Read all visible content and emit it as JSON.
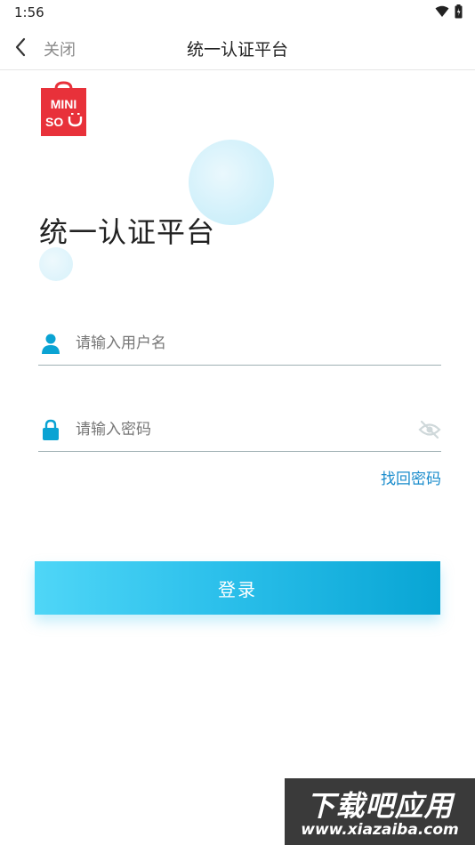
{
  "status_bar": {
    "time": "1:56",
    "icons": [
      "wifi-icon",
      "battery-icon"
    ]
  },
  "nav": {
    "close_label": "关闭",
    "title": "统一认证平台",
    "back_icon": "chevron-left-icon"
  },
  "logo": {
    "line1": "MINI",
    "line2": "SO",
    "brand_color": "#e8313a"
  },
  "main": {
    "title": "统一认证平台"
  },
  "form": {
    "username": {
      "placeholder": "请输入用户名",
      "value": "",
      "icon": "user-icon"
    },
    "password": {
      "placeholder": "请输入密码",
      "value": "",
      "icon": "lock-icon",
      "toggle_icon": "eye-off-icon"
    },
    "forgot_label": "找回密码",
    "login_label": "登录"
  },
  "colors": {
    "accent": "#1aa6d6",
    "link": "#1a8ccc",
    "button_gradient_start": "#4fd6f7",
    "button_gradient_end": "#08a5d4"
  },
  "watermark": {
    "line1": "下载吧应用",
    "line2": "www.xiazaiba.com"
  }
}
